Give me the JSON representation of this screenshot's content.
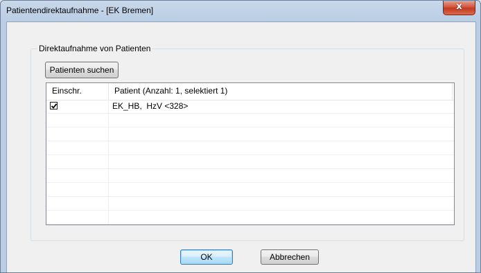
{
  "window": {
    "title": "Patientendirektaufnahme - [EK Bremen]",
    "close_glyph": "x"
  },
  "group": {
    "label": "Direktaufnahme von Patienten",
    "search_button": "Patienten suchen"
  },
  "table": {
    "columns": [
      "Einschr.",
      "Patient (Anzahl: 1, selektiert 1)"
    ],
    "rows": [
      {
        "checked": true,
        "patient": "EK_HB,  HzV <328>"
      }
    ]
  },
  "buttons": {
    "ok": "OK",
    "cancel": "Abbrechen"
  },
  "colors": {
    "close_button": "#c23a20",
    "default_button_border": "#3c7fb1"
  }
}
